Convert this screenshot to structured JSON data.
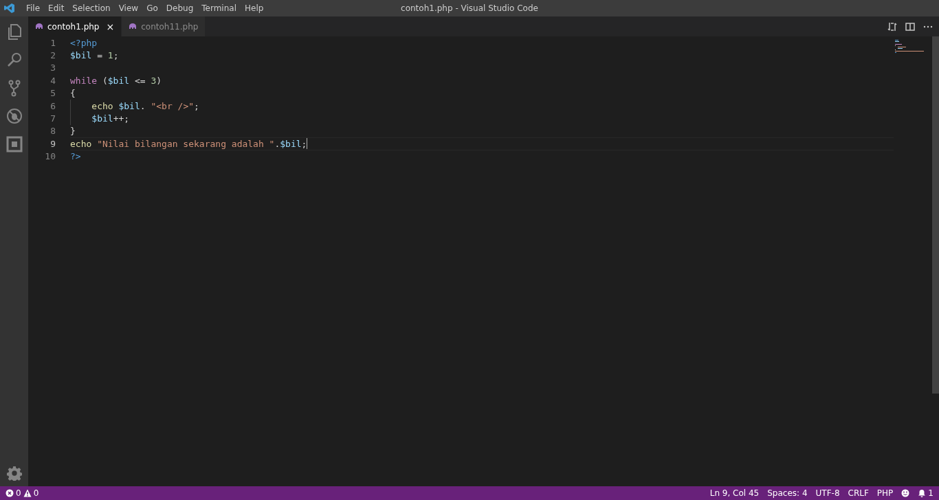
{
  "menu": [
    "File",
    "Edit",
    "Selection",
    "View",
    "Go",
    "Debug",
    "Terminal",
    "Help"
  ],
  "window": {
    "title": "contoh1.php - Visual Studio Code"
  },
  "activity_bar": [
    {
      "kind": "files",
      "selected": false
    },
    {
      "kind": "search",
      "selected": false
    },
    {
      "kind": "git",
      "selected": false
    },
    {
      "kind": "debug",
      "selected": false
    },
    {
      "kind": "extensions",
      "selected": false
    }
  ],
  "tabs": [
    {
      "label": "contoh1.php",
      "close": "×",
      "selected": true
    },
    {
      "label": "contoh11.php",
      "selected": false
    }
  ],
  "editor": {
    "lines": [
      {
        "number": "1",
        "current": false,
        "indent_guide": false,
        "tokens": [
          {
            "text": "<?php",
            "kind": "tag"
          }
        ]
      },
      {
        "number": "2",
        "current": false,
        "indent_guide": false,
        "tokens": [
          {
            "text": "$bil",
            "kind": "var"
          },
          {
            "text": " = ",
            "kind": "op"
          },
          {
            "text": "1",
            "kind": "num"
          },
          {
            "text": ";",
            "kind": "op"
          }
        ]
      },
      {
        "number": "3",
        "current": false,
        "indent_guide": false
      },
      {
        "number": "4",
        "current": false,
        "indent_guide": false,
        "tokens": [
          {
            "text": "while",
            "kind": "keyword"
          },
          {
            "text": " (",
            "kind": "op"
          },
          {
            "text": "$bil",
            "kind": "var"
          },
          {
            "text": " <= ",
            "kind": "op"
          },
          {
            "text": "3",
            "kind": "num"
          },
          {
            "text": ")",
            "kind": "op"
          }
        ]
      },
      {
        "number": "5",
        "current": false,
        "indent_guide": false,
        "tokens": [
          {
            "text": "{",
            "kind": "op"
          }
        ]
      },
      {
        "number": "6",
        "current": false,
        "indent_guide": true,
        "tokens": [
          {
            "text": "    echo",
            "kind": "func"
          },
          {
            "text": " $bil",
            "kind": "var"
          },
          {
            "text": ". ",
            "kind": "op"
          },
          {
            "text": "\"<br />\"",
            "kind": "str"
          },
          {
            "text": ";",
            "kind": "op"
          }
        ]
      },
      {
        "number": "7",
        "current": false,
        "indent_guide": true,
        "tokens": [
          {
            "text": "    $bil",
            "kind": "var"
          },
          {
            "text": "++;",
            "kind": "op"
          }
        ]
      },
      {
        "number": "8",
        "current": false,
        "indent_guide": false,
        "tokens": [
          {
            "text": "}",
            "kind": "op"
          }
        ]
      },
      {
        "number": "9",
        "current": true,
        "indent_guide": false,
        "tokens": [
          {
            "text": "echo",
            "kind": "func"
          },
          {
            "text": " \"Nilai bilangan sekarang adalah \"",
            "kind": "str"
          },
          {
            "text": ".",
            "kind": "op"
          },
          {
            "text": "$bil",
            "kind": "var"
          },
          {
            "text": ";",
            "kind": "op"
          }
        ]
      },
      {
        "number": "10",
        "current": false,
        "indent_guide": false,
        "tokens": [
          {
            "text": "?>",
            "kind": "tag"
          }
        ]
      }
    ]
  },
  "status_bar": {
    "errors": "0",
    "warnings": "0",
    "items": [
      "Ln 9, Col 45",
      "Spaces: 4",
      "UTF-8",
      "CRLF",
      "PHP"
    ],
    "notifications": "1"
  }
}
